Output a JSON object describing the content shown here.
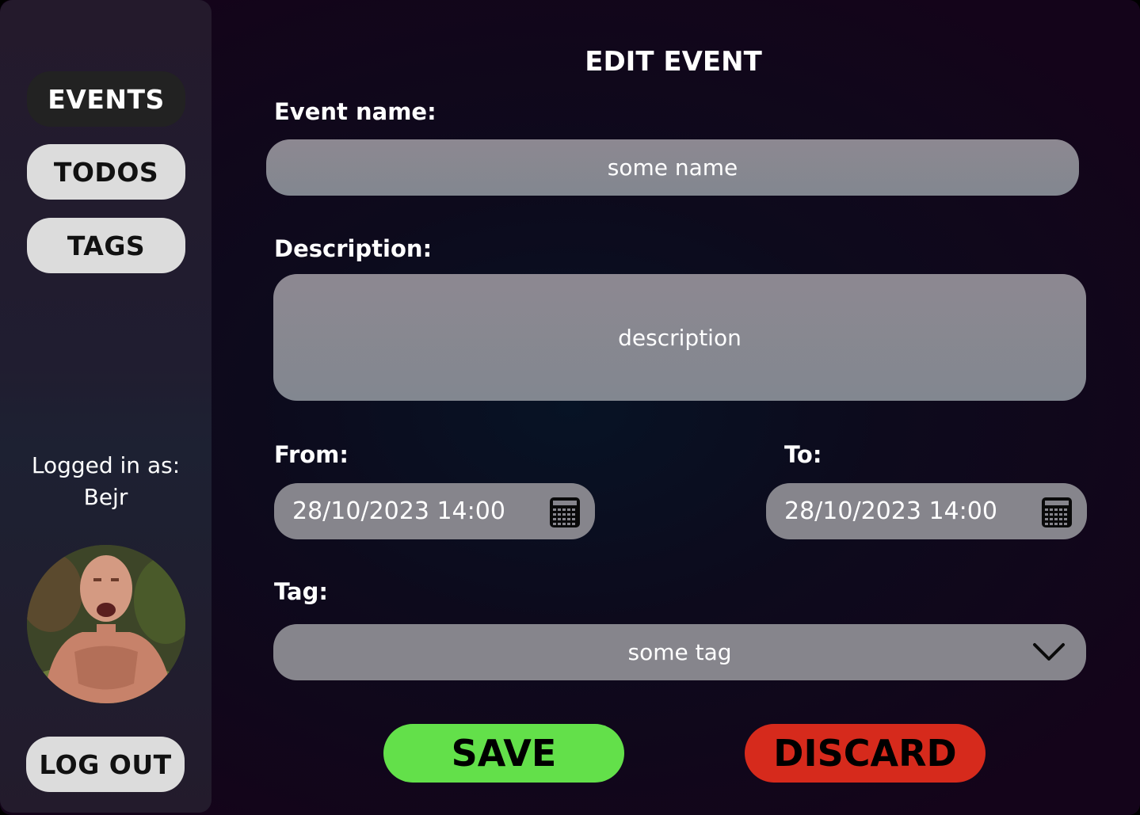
{
  "sidebar": {
    "nav": [
      {
        "label": "EVENTS",
        "active": true
      },
      {
        "label": "TODOS",
        "active": false
      },
      {
        "label": "TAGS",
        "active": false
      }
    ],
    "logged_in_label": "Logged in as:",
    "username": "Bejr",
    "logout_label": "LOG OUT"
  },
  "form": {
    "title": "EDIT EVENT",
    "name_label": "Event name:",
    "name_value": "some name",
    "description_label": "Description:",
    "description_value": "description",
    "from_label": "From:",
    "from_value": "28/10/2023 14:00",
    "to_label": "To:",
    "to_value": "28/10/2023 14:00",
    "tag_label": "Tag:",
    "tag_value": "some tag",
    "save_label": "SAVE",
    "discard_label": "DISCARD"
  },
  "icons": {
    "from_calendar": "calendar-icon",
    "to_calendar": "calendar-icon",
    "tag_dropdown": "chevron-down-icon"
  },
  "colors": {
    "active_nav": "#222222",
    "inactive_nav": "#dcdcdc",
    "field": "#86858c",
    "save": "#63e04a",
    "discard": "#d62a1c"
  }
}
